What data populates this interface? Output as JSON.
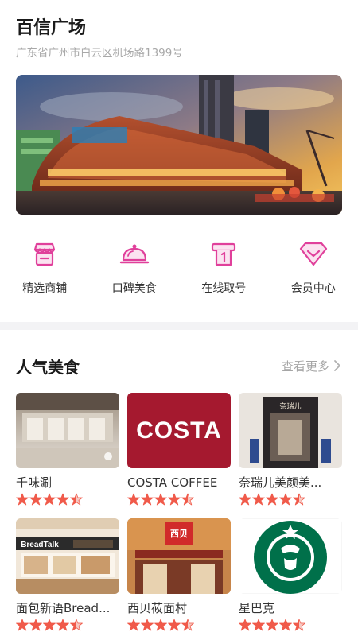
{
  "header": {
    "title": "百信广场",
    "address": "广东省广州市白云区机场路1399号"
  },
  "banner": {
    "image": "mall-exterior-sunset-photo"
  },
  "quick_menu": [
    {
      "label": "精选商铺",
      "icon": "shop-icon"
    },
    {
      "label": "口碑美食",
      "icon": "food-cloche-icon"
    },
    {
      "label": "在线取号",
      "icon": "queue-ticket-icon"
    },
    {
      "label": "会员中心",
      "icon": "member-diamond-icon"
    }
  ],
  "section": {
    "title": "人气美食",
    "more_label": "查看更多"
  },
  "restaurants": [
    {
      "name": "千味涮",
      "rating": 4.5
    },
    {
      "name": "COSTA COFFEE",
      "rating": 4.5,
      "logo_text": "COSTA"
    },
    {
      "name": "奈瑞儿美颜美...",
      "rating": 4.5,
      "sign_text": "奈瑞儿"
    },
    {
      "name": "面包新语Bread...",
      "rating": 4.5,
      "sign_text": "BreadTalk"
    },
    {
      "name": "西贝莜面村",
      "rating": 4.5,
      "sign_text": "西贝"
    },
    {
      "name": "星巴克",
      "rating": 4.5
    }
  ],
  "colors": {
    "accent": "#e0409b",
    "star": "#f05a4a",
    "star_empty": "#f6c9c3",
    "costa_red": "#a5192f",
    "starbucks_green": "#00704a"
  }
}
